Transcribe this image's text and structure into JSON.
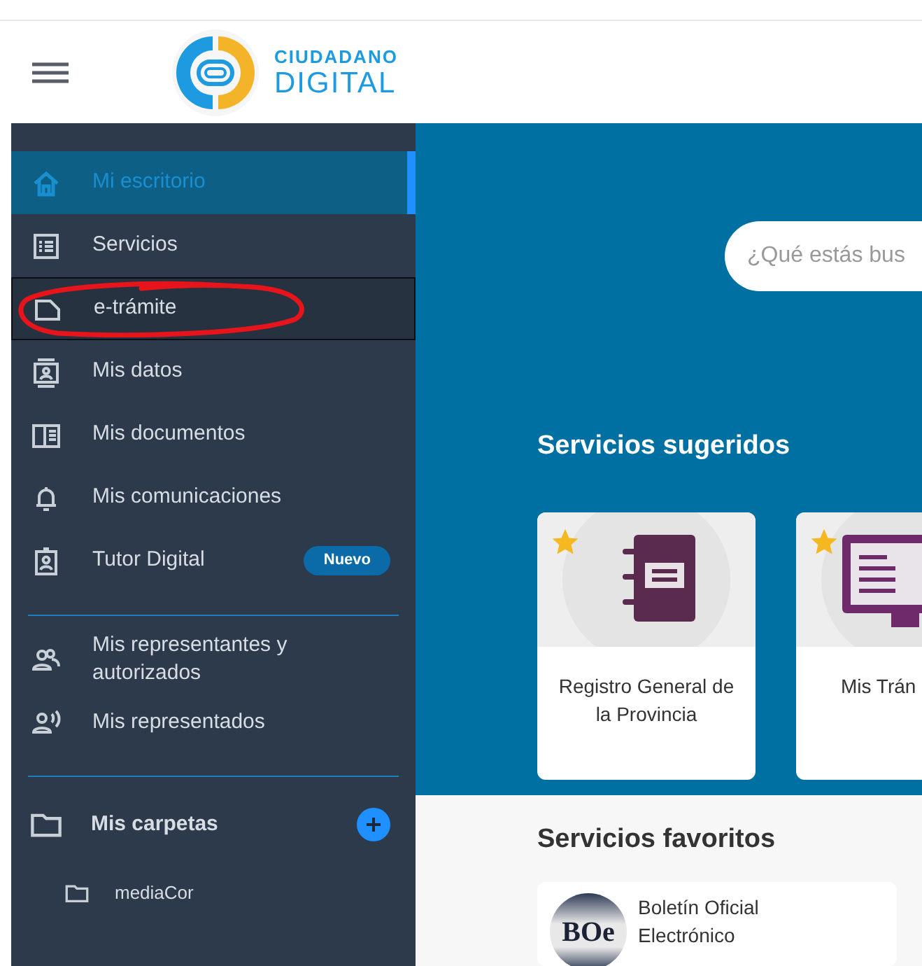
{
  "header": {
    "logo": {
      "line1": "CIUDADANO",
      "line2": "DIGITAL"
    }
  },
  "sidebar": {
    "menu": [
      {
        "label": "Mi escritorio",
        "selected": true,
        "focused": false
      },
      {
        "label": "Servicios",
        "selected": false,
        "focused": false
      },
      {
        "label": "e-trámite",
        "selected": false,
        "focused": true,
        "annotation": {
          "kind": "circle",
          "color": "#e8141b"
        }
      },
      {
        "label": "Mis datos",
        "selected": false,
        "focused": false
      },
      {
        "label": "Mis documentos",
        "selected": false,
        "focused": false
      },
      {
        "label": "Mis comunicaciones",
        "selected": false,
        "focused": false
      },
      {
        "label": "Tutor Digital",
        "selected": false,
        "focused": false,
        "badge": "Nuevo"
      }
    ],
    "people": [
      {
        "label": "Mis representantes y autorizados"
      },
      {
        "label": "Mis representados"
      }
    ],
    "folders": {
      "title": "Mis carpetas",
      "items": [
        {
          "label": "mediaCor"
        }
      ]
    }
  },
  "main": {
    "search": {
      "placeholder": "¿Qué estás bus"
    },
    "suggested": {
      "title": "Servicios sugeridos",
      "cards": [
        {
          "label": "Registro General de la Provincia",
          "favorite": true
        },
        {
          "label": "Mis Trán",
          "favorite": true
        }
      ]
    },
    "favorites": {
      "title": "Servicios favoritos",
      "items": [
        {
          "logo": "BOe",
          "label": "Boletín Oficial Electrónico"
        }
      ]
    }
  }
}
